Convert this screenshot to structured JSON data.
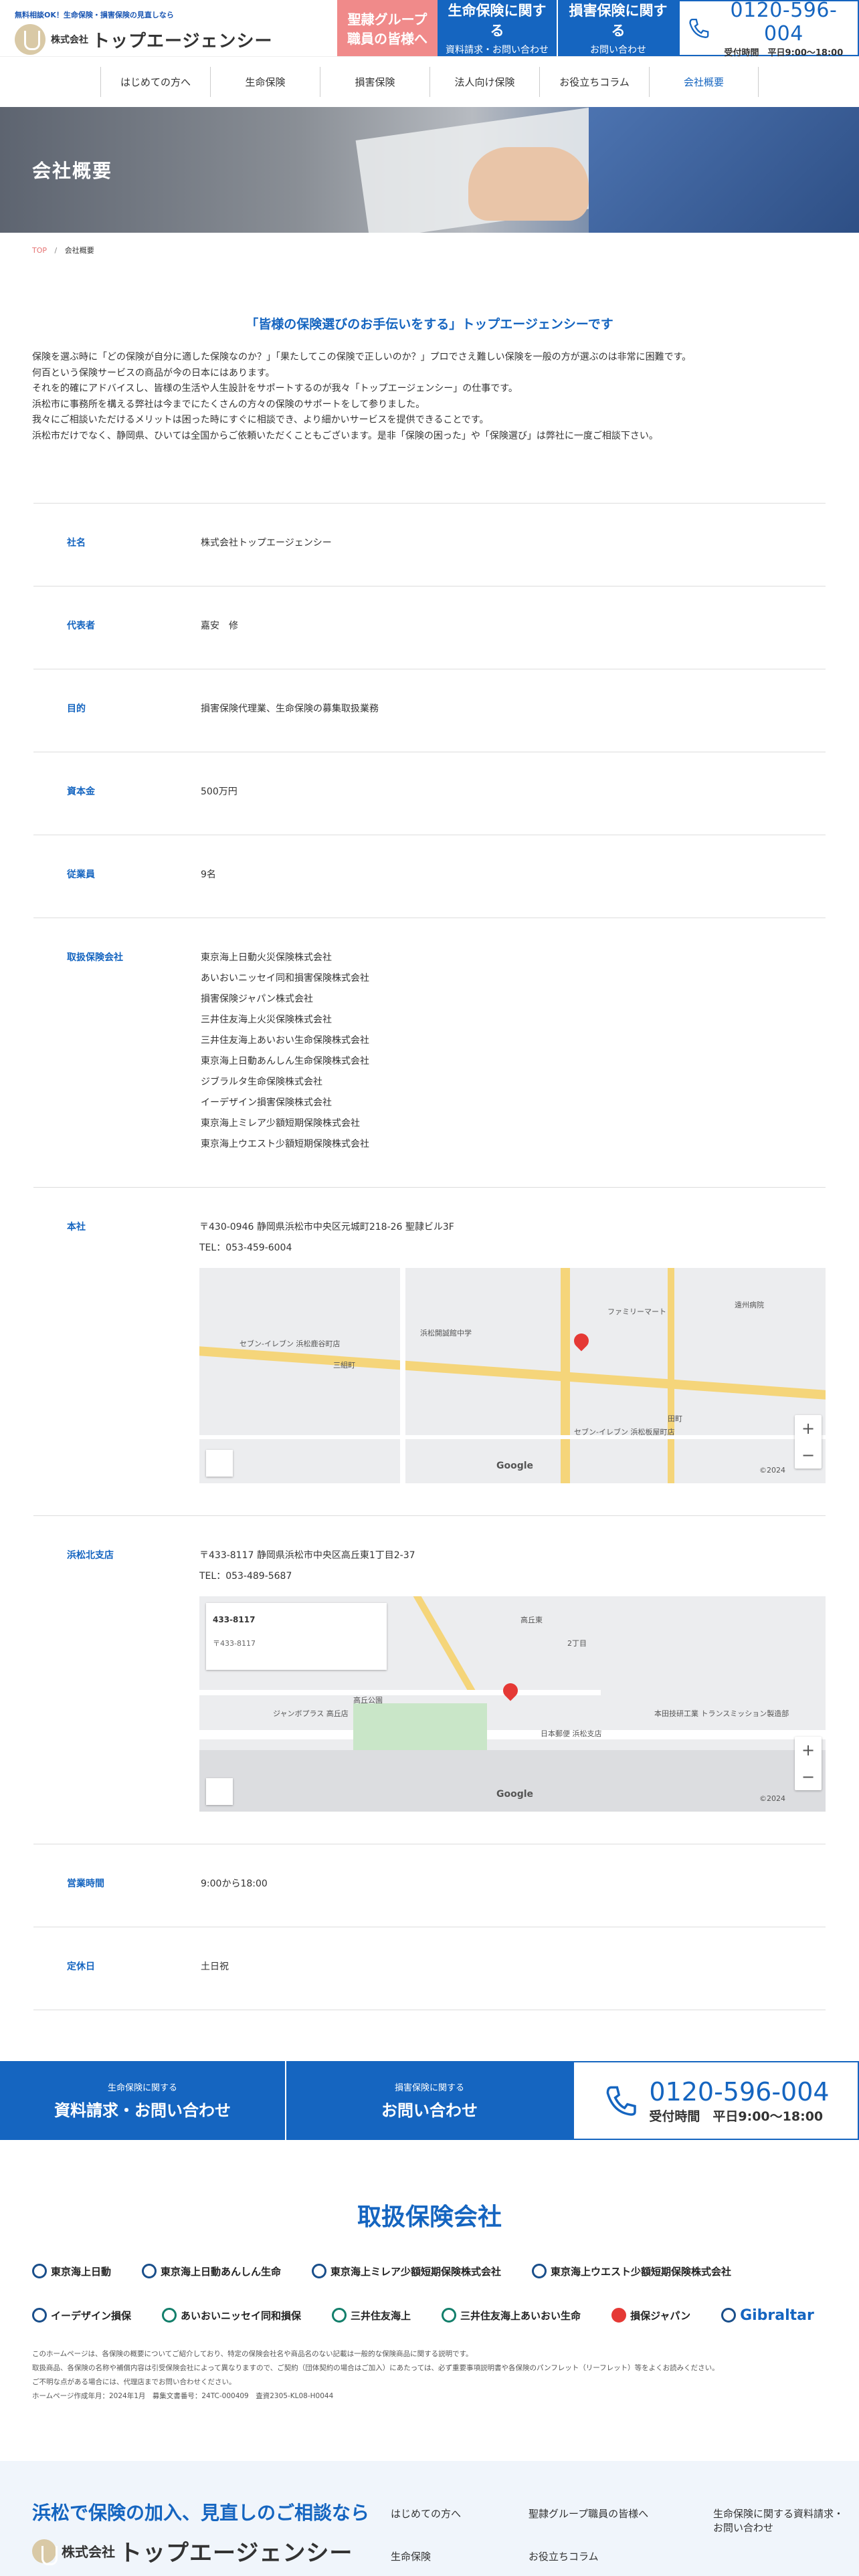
{
  "header": {
    "tagline": "無料相談OK！生命保険・損害保険の見直しなら",
    "logo_kabu": "株式会社",
    "logo_name": "トップエージェンシー",
    "pink_btn": {
      "line1": "聖隷グループ",
      "line2": "職員の皆様へ"
    },
    "life_btn": {
      "line1": "生命保険に関する",
      "line2": "資料請求・お問い合わせ"
    },
    "nonlife_btn": {
      "line1": "損害保険に関する",
      "line2": "お問い合わせ"
    },
    "tel": {
      "number": "0120-596-004",
      "hours": "受付時間　平日9:00～18:00"
    }
  },
  "nav": [
    {
      "label": "はじめての方へ"
    },
    {
      "label": "生命保険"
    },
    {
      "label": "損害保険"
    },
    {
      "label": "法人向け保険"
    },
    {
      "label": "お役立ちコラム"
    },
    {
      "label": "会社概要"
    }
  ],
  "hero": {
    "title": "会社概要"
  },
  "breadcrumb": {
    "top": "TOP",
    "sep": "/",
    "current": "会社概要"
  },
  "intro": {
    "title": "「皆様の保険選びのお手伝いをする」トップエージェンシーです",
    "lines": [
      "保険を選ぶ時に「どの保険が自分に適した保険なのか？」「果たしてこの保険で正しいのか？」プロでさえ難しい保険を一般の方が選ぶのは非常に困難です。",
      "何百という保険サービスの商品が今の日本にはあります。",
      "それを的確にアドバイスし、皆様の生活や人生設計をサポートするのが我々「トップエージェンシー」の仕事です。",
      "浜松市に事務所を構える弊社は今までにたくさんの方々の保険のサポートをして参りました。",
      "我々にご相談いただけるメリットは困った時にすぐに相談でき、より細かいサービスを提供できることです。",
      "浜松市だけでなく、静岡県、ひいては全国からご依頼いただくこともございます。是非「保険の困った」や「保険選び」は弊社に一度ご相談下さい。"
    ]
  },
  "company": {
    "name": {
      "label": "社名",
      "value": "株式会社トップエージェンシー"
    },
    "rep": {
      "label": "代表者",
      "value": "嘉安　修"
    },
    "purpose": {
      "label": "目的",
      "value": "損害保険代理業、生命保険の募集取扱業務"
    },
    "capital": {
      "label": "資本金",
      "value": "500万円"
    },
    "staff": {
      "label": "従業員",
      "value": "9名"
    },
    "insurers": {
      "label": "取扱保険会社",
      "values": [
        "東京海上日動火災保険株式会社",
        "あいおいニッセイ同和損害保険株式会社",
        "損害保険ジャパン株式会社",
        "三井住友海上火災保険株式会社",
        "三井住友海上あいおい生命保険株式会社",
        "東京海上日動あんしん生命保険株式会社",
        "ジブラルタ生命保険株式会社",
        "イーデザイン損害保険株式会社",
        "東京海上ミレア少額短期保険株式会社",
        "東京海上ウエスト少額短期保険株式会社"
      ]
    },
    "hq": {
      "label": "本社",
      "address": "〒430-0946 静岡県浜松市中央区元城町218-26 聖隷ビル3F",
      "tel": "TEL：053-459-6004"
    },
    "branch": {
      "label": "浜松北支店",
      "address": "〒433-8117 静岡県浜松市中央区高丘東1丁目2-37",
      "tel": "TEL：053-489-5687"
    },
    "hours": {
      "label": "営業時間",
      "value": "9:00から18:00"
    },
    "holidays": {
      "label": "定休日",
      "value": "土日祝"
    }
  },
  "map1": {
    "labels": [
      "セブン-イレブン 浜松鹿谷町店",
      "浜松開誠館中学",
      "三組町",
      "ファミリーマート",
      "遠州病院",
      "田町",
      "セブン-イレブン 浜松板屋町店",
      "Google",
      "©2024"
    ],
    "zoom_in": "+",
    "zoom_out": "−"
  },
  "map2": {
    "info_title": "433-8117",
    "info_sub": "〒433-8117",
    "labels": [
      "ジャンボプラス 高丘店",
      "高丘公園",
      "高丘東",
      "2丁目",
      "本田技研工業 トランスミッション製造部",
      "日本郵便 浜松支店",
      "Google",
      "©2024"
    ],
    "zoom_in": "+",
    "zoom_out": "−"
  },
  "cta": {
    "life": {
      "small": "生命保険に関する",
      "big": "資料請求・お問い合わせ"
    },
    "nonlife": {
      "small": "損害保険に関する",
      "big": "お問い合わせ"
    },
    "tel": {
      "number": "0120-596-004",
      "hours": "受付時間　平日9:00～18:00"
    }
  },
  "insurers_section": {
    "title": "取扱保険会社",
    "logos": [
      {
        "name": "東京海上日動"
      },
      {
        "name": "東京海上日動あんしん生命"
      },
      {
        "name": "東京海上ミレア少額短期保険株式会社"
      },
      {
        "name": "東京海上ウエスト少額短期保険株式会社"
      },
      {
        "name": "イーデザイン損保"
      },
      {
        "name": "あいおいニッセイ同和損保"
      },
      {
        "name": "三井住友海上"
      },
      {
        "name": "三井住友海上あいおい生命"
      },
      {
        "name": "損保ジャパン"
      },
      {
        "name": "Gibraltar"
      }
    ],
    "disclaimer": [
      "このホームページは、各保険の概要についてご紹介しており、特定の保険会社名や商品名のない記載は一般的な保険商品に関する説明です。",
      "取扱商品、各保険の名称や補償内容は引受保険会社によって異なりますので、ご契約（団体契約の場合はご加入）にあたっては、必ず重要事項説明書や各保険のパンフレット（リーフレット）等をよくお読みください。",
      "ご不明な点がある場合には、代理店までお問い合わせください。",
      "ホームページ作成年月：2024年1月　募集文書番号：24TC-000409　査資2305-KL08-H0044"
    ]
  },
  "footer": {
    "lead": "浜松で保険の加入、見直しのご相談なら",
    "kabu": "株式会社",
    "name": "トップエージェンシー",
    "links": [
      {
        "label": "はじめての方へ"
      },
      {
        "label": "聖隷グループ職員の皆様へ"
      },
      {
        "label": "生命保険に関する資料請求・お問い合わせ"
      },
      {
        "label": "生命保険"
      },
      {
        "label": "お役立ちコラム"
      }
    ]
  },
  "colors": {
    "brand": "#1565c0",
    "pink": "#f08a8a"
  }
}
